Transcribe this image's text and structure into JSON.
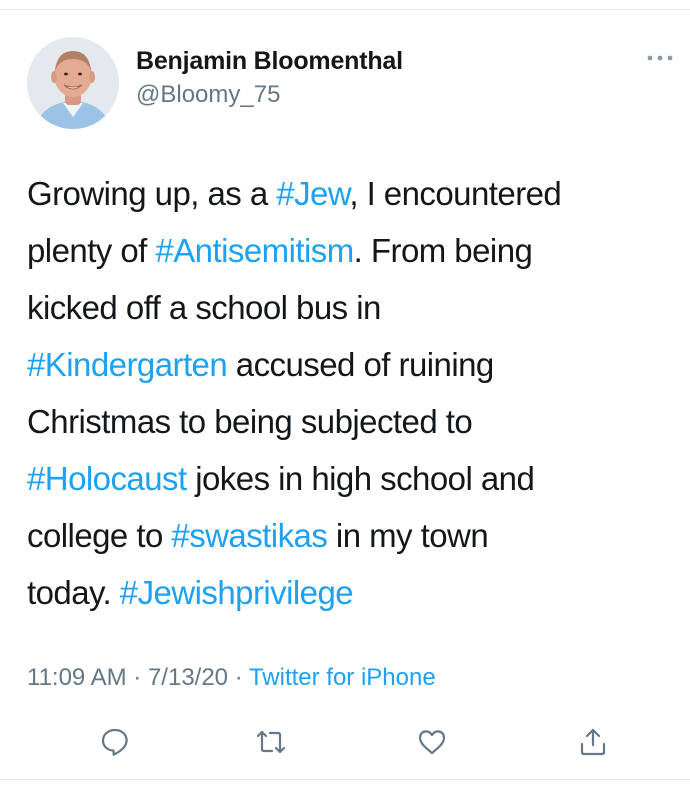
{
  "tweet": {
    "author": {
      "display_name": "Benjamin Bloomenthal",
      "handle": "@Bloomy_75",
      "avatar_icon": "profile-photo"
    },
    "more_icon": "more-horizontal-icon",
    "body_lines": [
      [
        {
          "t": "Growing up, as a ",
          "tag": false
        },
        {
          "t": "#Jew",
          "tag": true
        },
        {
          "t": ", I encountered",
          "tag": false
        }
      ],
      [
        {
          "t": "plenty of ",
          "tag": false
        },
        {
          "t": "#Antisemitism",
          "tag": true
        },
        {
          "t": ".  From being",
          "tag": false
        }
      ],
      [
        {
          "t": "kicked off a school bus in",
          "tag": false
        }
      ],
      [
        {
          "t": "#Kindergarten",
          "tag": true
        },
        {
          "t": " accused of ruining",
          "tag": false
        }
      ],
      [
        {
          "t": "Christmas to being subjected to",
          "tag": false
        }
      ],
      [
        {
          "t": "#Holocaust",
          "tag": true
        },
        {
          "t": " jokes in high school and",
          "tag": false
        }
      ],
      [
        {
          "t": "college to ",
          "tag": false
        },
        {
          "t": "#swastikas",
          "tag": true
        },
        {
          "t": " in my town",
          "tag": false
        }
      ],
      [
        {
          "t": "today.  ",
          "tag": false
        },
        {
          "t": "#Jewishprivilege",
          "tag": true
        }
      ]
    ],
    "meta": {
      "time": "11:09 AM",
      "sep1": " · ",
      "date": "7/13/20",
      "sep2": " · ",
      "source": "Twitter for iPhone"
    },
    "actions": [
      {
        "name": "reply-icon"
      },
      {
        "name": "retweet-icon"
      },
      {
        "name": "like-icon"
      },
      {
        "name": "share-icon"
      }
    ]
  },
  "colors": {
    "link": "#1da1f2",
    "secondary": "#657786",
    "text": "#14171a",
    "divider": "#e1e8ed"
  }
}
